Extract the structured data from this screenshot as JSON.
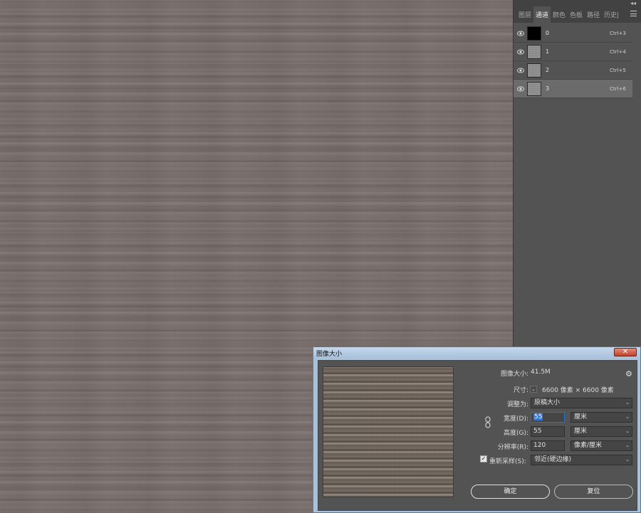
{
  "channels_panel": {
    "tabs": [
      {
        "label": "图层"
      },
      {
        "label": "通道"
      },
      {
        "label": "颜色"
      },
      {
        "label": "色板"
      },
      {
        "label": "路径"
      },
      {
        "label": "历史|"
      }
    ],
    "active_tab": 1,
    "channels": [
      {
        "name": "0",
        "shortcut": "Ctrl+3",
        "thumb": "black"
      },
      {
        "name": "1",
        "shortcut": "Ctrl+4",
        "thumb": "texture"
      },
      {
        "name": "2",
        "shortcut": "Ctrl+5",
        "thumb": "texture"
      },
      {
        "name": "3",
        "shortcut": "Ctrl+6",
        "thumb": "texture"
      }
    ],
    "selected_channel": 3,
    "icons": [
      "eye-icon",
      "panel-menu-icon",
      "collapse-icon"
    ]
  },
  "dialog": {
    "title": "图像大小",
    "close_symbol": "✕",
    "image_size_label": "图像大小:",
    "image_size_value": "41.5M",
    "dimensions_label": "尺寸:",
    "dimensions_value": "6600 像素 × 6600 像素",
    "fit_to_label": "调整为:",
    "fit_to_value": "原稿大小",
    "width_label": "宽度(D):",
    "width_value": "55",
    "width_unit": "厘米",
    "height_label": "高度(G):",
    "height_value": "55",
    "height_unit": "厘米",
    "resolution_label": "分辨率(R):",
    "resolution_value": "120",
    "resolution_unit": "像素/厘米",
    "resample_label": "重新采样(S):",
    "resample_checked": true,
    "resample_value": "邻近(硬边缘)",
    "ok_label": "确定",
    "reset_label": "复位"
  },
  "colors": {
    "canvas": "#786d6b",
    "panel": "#535353",
    "dialog_frame": "#a9c1dc",
    "close_button": "#c2412a",
    "selection": "#3478d0"
  }
}
